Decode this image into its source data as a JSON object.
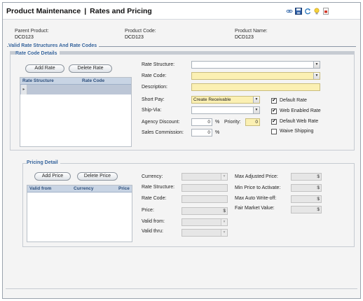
{
  "header": {
    "title_left": "Product Maintenance",
    "title_sep": "|",
    "title_right": "Rates and Pricing",
    "toolbar_icons": [
      "link-icon",
      "save-icon",
      "refresh-icon",
      "lightbulb-icon",
      "report-icon"
    ]
  },
  "product_info": {
    "parent_label": "Parent Product:",
    "parent_value": "DCD123",
    "code_label": "Product Code:",
    "code_value": "DCD123",
    "name_label": "Product Name:",
    "name_value": "DCD123"
  },
  "valid_rates": {
    "section_title": "Valid Rate Structures And Rate Codes",
    "subsection_title": "Rate Code Details",
    "add_label": "Add Rate",
    "delete_label": "Delete Rate",
    "columns": [
      "Rate Structure",
      "Rate Code"
    ],
    "row_indicator": "▸"
  },
  "rate_form": {
    "rate_structure_label": "Rate Structure:",
    "rate_structure_value": "",
    "rate_code_label": "Rate Code:",
    "rate_code_value": "",
    "description_label": "Description:",
    "description_value": "",
    "short_pay_label": "Short Pay:",
    "short_pay_value": "Create Receivable",
    "ship_via_label": "Ship-Via:",
    "ship_via_value": "",
    "agency_discount_label": "Agency Discount:",
    "agency_discount_value": "0",
    "percent_symbol": "%",
    "priority_label": "Priority:",
    "priority_value": "0",
    "sales_commission_label": "Sales Commission:",
    "sales_commission_value": "0",
    "dropdown_arrow": "▼",
    "checkboxes": {
      "default_rate": {
        "label": "Default Rate",
        "checked": true
      },
      "web_enabled_rate": {
        "label": "Web Enabled Rate",
        "checked": true
      },
      "default_web_rate": {
        "label": "Default Web Rate",
        "checked": true
      },
      "waive_shipping": {
        "label": "Waive Shipping",
        "checked": false
      }
    },
    "check_mark": "✔"
  },
  "pricing": {
    "section_title": "Pricing Detail",
    "add_label": "Add Price",
    "delete_label": "Delete Price",
    "columns": [
      "Valid from",
      "Currency",
      "Price"
    ],
    "currency_label": "Currency:",
    "rate_structure_label": "Rate Structure:",
    "rate_code_label": "Rate Code:",
    "price_label": "Price:",
    "valid_from_label": "Valid from:",
    "valid_thru_label": "Valid thru:",
    "currency_symbol": "$",
    "max_adjusted_label": "Max Adjusted Price:",
    "min_price_label": "Min Price to Activate:",
    "max_auto_label": "Max Auto Write-off:",
    "fair_market_label": "Fair Market Value:"
  },
  "colors": {
    "required_field": "#fbf0b3",
    "grid_header": "#c8d4e4",
    "section_title": "#36649c"
  }
}
